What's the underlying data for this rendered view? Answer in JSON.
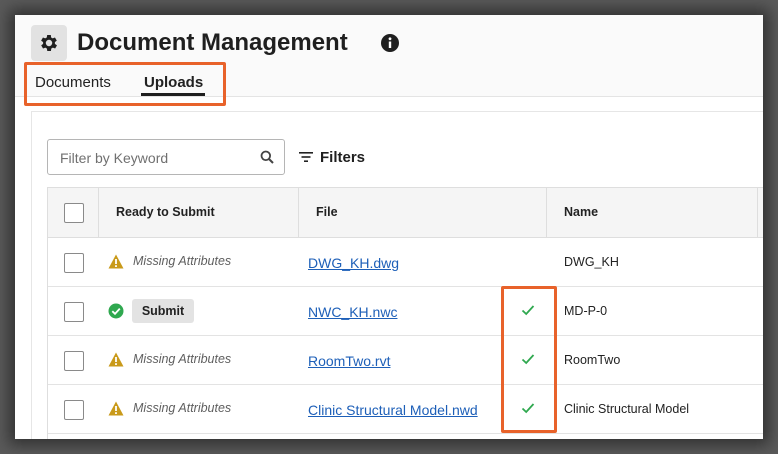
{
  "header": {
    "title": "Document Management",
    "icons": {
      "settings": "gear-icon",
      "info": "info-icon"
    }
  },
  "tabs": [
    {
      "label": "Documents",
      "active": false
    },
    {
      "label": "Uploads",
      "active": true
    }
  ],
  "toolbar": {
    "search_placeholder": "Filter by Keyword",
    "search_value": "",
    "filters_label": "Filters"
  },
  "table": {
    "columns": [
      "Ready to Submit",
      "File",
      "Name"
    ],
    "rows": [
      {
        "status": "Missing Attributes",
        "status_type": "warning",
        "file": "DWG_KH.dwg",
        "uploaded": false,
        "name": "DWG_KH"
      },
      {
        "status": "Submit",
        "status_type": "ready",
        "file": "NWC_KH.nwc",
        "uploaded": true,
        "name": "MD-P-0"
      },
      {
        "status": "Missing Attributes",
        "status_type": "warning",
        "file": "RoomTwo.rvt",
        "uploaded": true,
        "name": "RoomTwo"
      },
      {
        "status": "Missing Attributes",
        "status_type": "warning",
        "file": "Clinic Structural Model.nwd",
        "uploaded": true,
        "name": "Clinic Structural Model"
      }
    ]
  },
  "colors": {
    "accent_outline": "#e8622a",
    "link": "#1d5fb8",
    "success": "#2fa84f",
    "warning": "#c99a1a"
  }
}
